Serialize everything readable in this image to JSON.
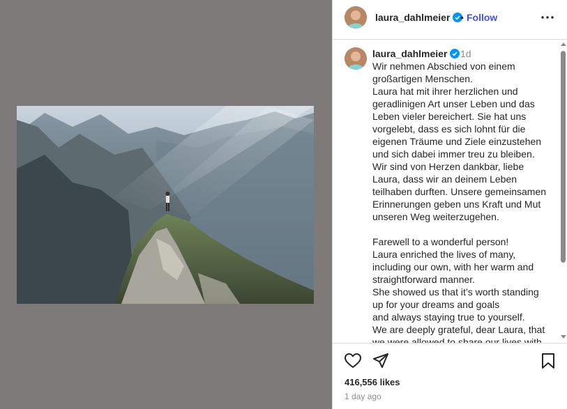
{
  "post": {
    "username": "laura_dahlmeier",
    "follow_label": "Follow",
    "dot": "•",
    "time_ago": "1d",
    "caption_lines": [
      "Wir nehmen Abschied von einem",
      "großartigen Menschen.",
      "Laura hat mit ihrer herzlichen und",
      "geradlinigen Art unser Leben und das",
      "Leben vieler bereichert. Sie hat uns",
      "vorgelebt, dass es sich lohnt für die",
      "eigenen Träume und Ziele einzustehen",
      "und sich dabei immer treu zu bleiben.",
      "Wir sind von Herzen dankbar, liebe",
      "Laura, dass wir an deinem Leben",
      "teilhaben durften. Unsere gemeinsamen",
      "Erinnerungen geben uns Kraft und Mut",
      "unseren Weg weiterzugehen.",
      "",
      "Farewell to a wonderful person!",
      "Laura enriched the lives of many,",
      "including our own, with her warm and",
      "straightforward manner.",
      "She showed us that it’s worth standing",
      "up for your dreams and goals",
      "and always staying true to yourself.",
      "We are deeply grateful, dear Laura, that",
      "we were allowed to share our lives with"
    ],
    "likes": "416,556 likes",
    "date": "1 day ago"
  },
  "icons": {
    "verified": "verified-badge-icon",
    "more": "more-options-icon",
    "like": "heart-icon",
    "share": "paper-plane-icon",
    "save": "bookmark-icon"
  },
  "colors": {
    "media_background": "#7f7a7a",
    "follow": "#4150f7",
    "verified": "#0095f6",
    "muted_text": "#8e8e8e",
    "text": "#262626"
  }
}
